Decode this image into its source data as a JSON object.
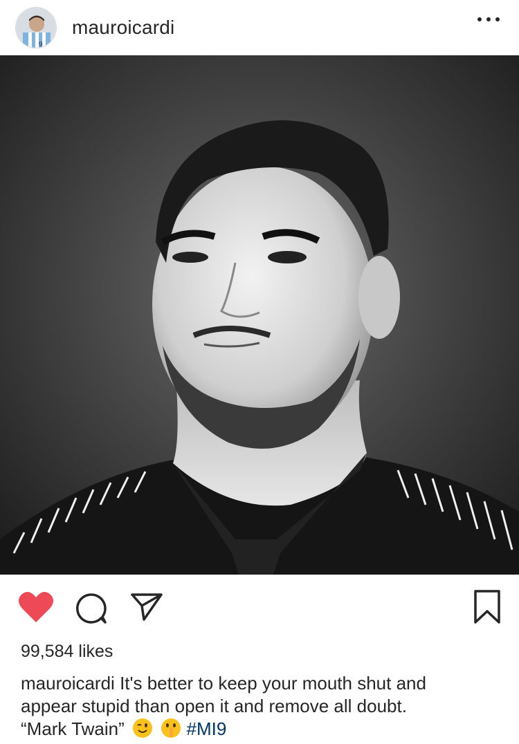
{
  "post": {
    "username": "mauroicardi",
    "likes": "99,584 likes",
    "caption_user": "mauroicardi",
    "caption_line1": "It's better to keep your mouth shut and",
    "caption_line2": "appear stupid than open it and remove all doubt.",
    "caption_line3": "“Mark Twain”",
    "hashtag": "#MI9"
  },
  "icons": {
    "more": "more-options-icon",
    "like": "heart-icon",
    "comment": "comment-icon",
    "share": "send-icon",
    "save": "bookmark-icon",
    "emoji1": "winking-face-emoji",
    "emoji2": "shushing-face-emoji"
  },
  "colors": {
    "like_red": "#ed4956",
    "text": "#262626",
    "hashtag": "#003569"
  }
}
